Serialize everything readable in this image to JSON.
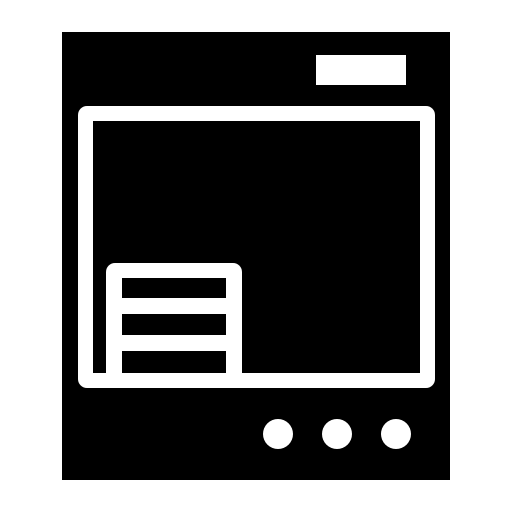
{
  "icon": {
    "name": "dishwasher-icon",
    "foreground": "#000000",
    "background": "#ffffff",
    "control_buttons": 3,
    "rack_slats": 3
  }
}
